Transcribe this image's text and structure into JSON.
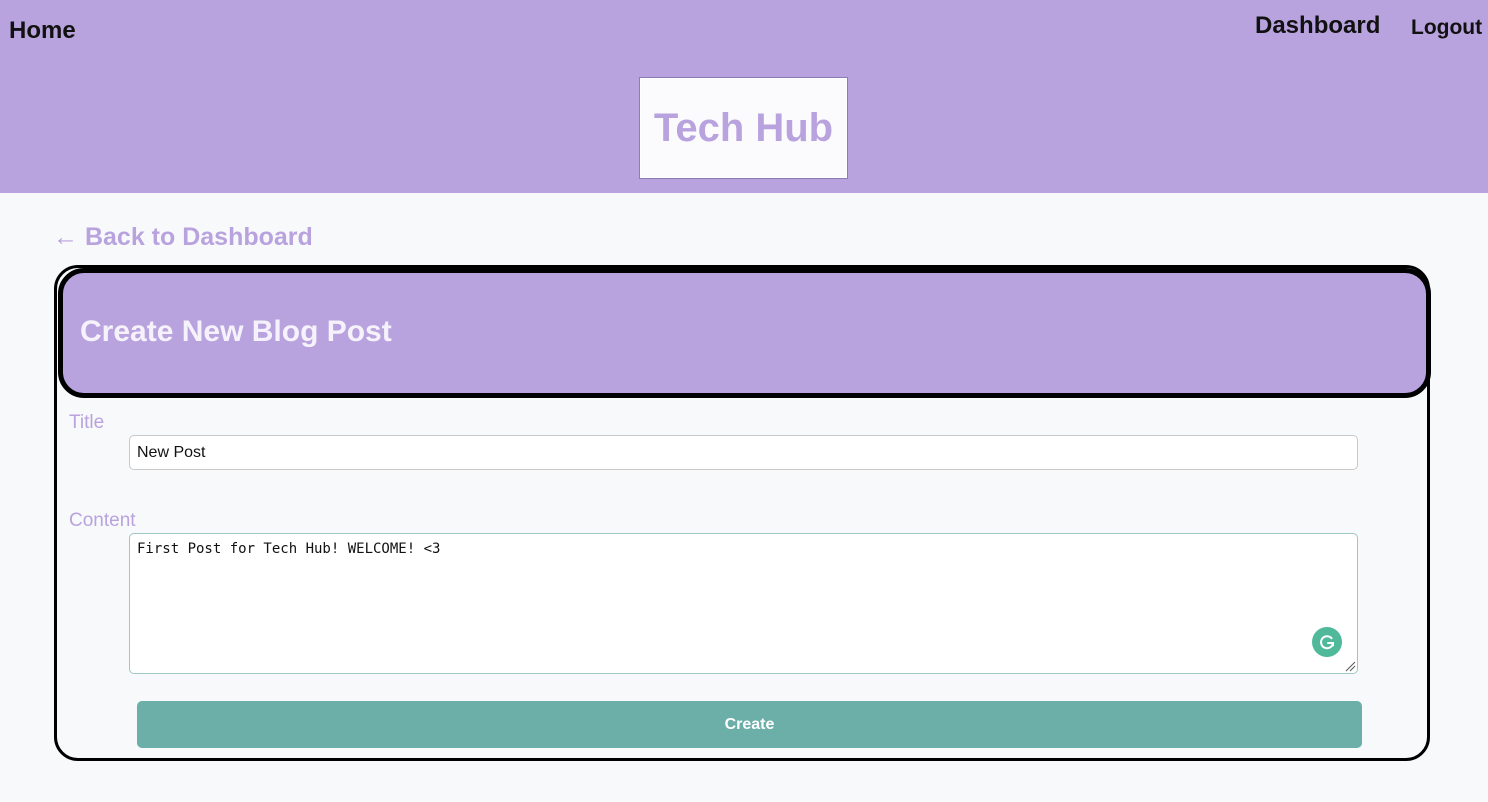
{
  "nav": {
    "home_label": "Home",
    "dashboard_label": "Dashboard",
    "logout_label": "Logout"
  },
  "site": {
    "title": "Tech Hub"
  },
  "back_link": {
    "arrow": "←",
    "label": "Back to Dashboard"
  },
  "form": {
    "heading": "Create New Blog Post",
    "title_label": "Title",
    "title_value": "New Post",
    "content_label": "Content",
    "content_value": "First Post for Tech Hub! WELCOME! <3",
    "submit_label": "Create"
  },
  "icons": {
    "grammar": "grammarly-icon",
    "resize": "resize-grip-icon"
  },
  "colors": {
    "accent": "#b9a3df",
    "button": "#6caea8",
    "grammarly": "#4fb99a",
    "border": "#000000"
  }
}
